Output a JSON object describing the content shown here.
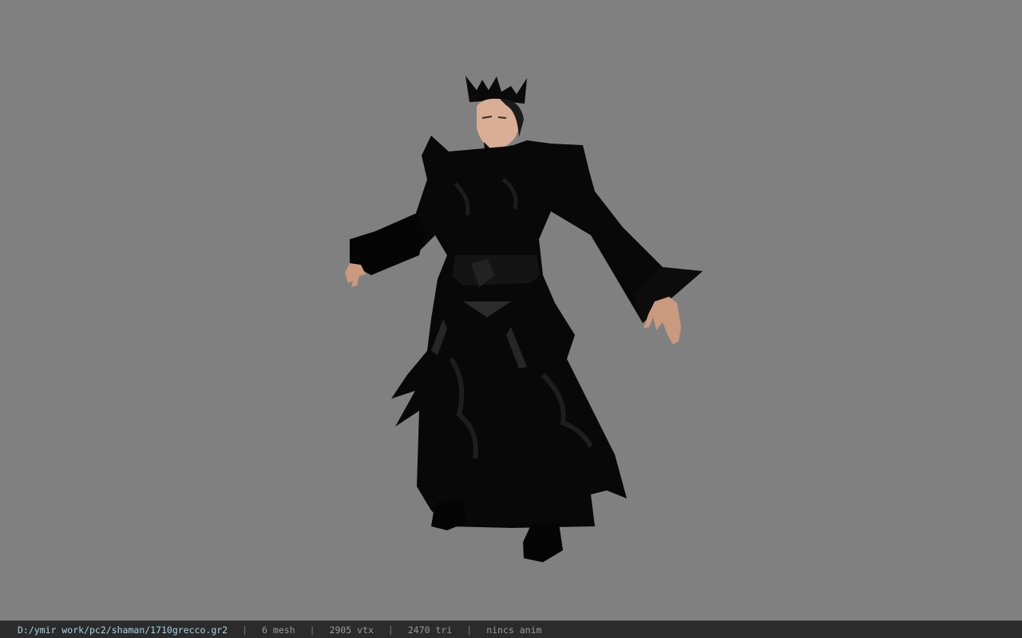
{
  "statusbar": {
    "file_path": "D:/ymir work/pc2/shaman/1710grecco.gr2",
    "separator": "|",
    "mesh": "6 mesh",
    "vertices": "2905 vtx",
    "triangles": "2470 tri",
    "animation": "nincs anim"
  },
  "colors": {
    "viewport_bg": "#808080",
    "statusbar_bg": "#2b2b2b",
    "path_text": "#a9d3e6",
    "stat_text": "#9a9a9a"
  }
}
